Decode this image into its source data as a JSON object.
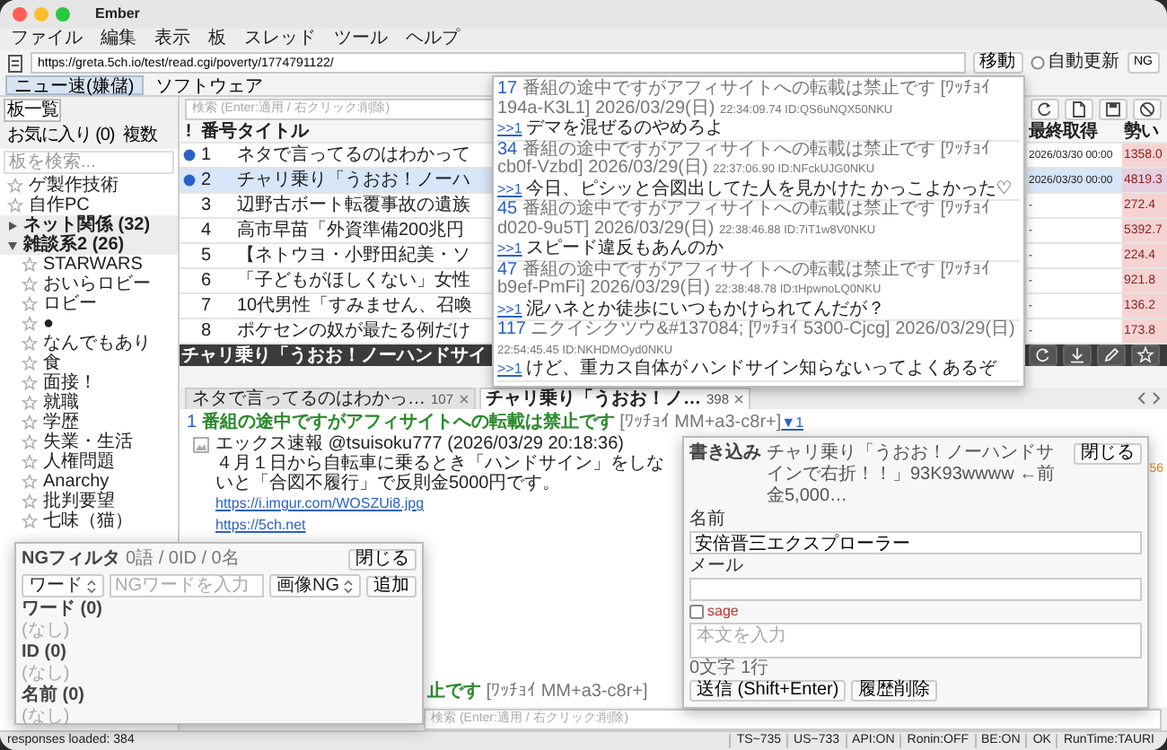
{
  "window": {
    "title": "Ember"
  },
  "menu": [
    "ファイル",
    "編集",
    "表示",
    "板",
    "スレッド",
    "ツール",
    "ヘルプ"
  ],
  "address_bar": {
    "url": "https://greta.5ch.io/test/read.cgi/poverty/1774791122/",
    "go_button": "移動",
    "auto_refresh": {
      "label": "自動更新",
      "checked": false
    },
    "ng_button": "NG"
  },
  "board_tabs": [
    {
      "label": "ニュー速(嫌儲)",
      "selected": true
    },
    {
      "label": "ソフトウェア",
      "selected": false
    }
  ],
  "sidebar": {
    "tabs": [
      {
        "label": "板一覧",
        "selected": true
      },
      {
        "label": "お気に入り (0)",
        "selected": false
      },
      {
        "label": "複数",
        "selected": false
      }
    ],
    "search": {
      "placeholder": "板を検索..."
    },
    "items": [
      {
        "kind": "board",
        "label": "ゲ製作技術"
      },
      {
        "kind": "board",
        "label": "自作PC"
      },
      {
        "kind": "category",
        "label": "ネット関係 (32)",
        "expanded": false
      },
      {
        "kind": "category",
        "label": "雑談系2 (26)",
        "expanded": true,
        "children": [
          {
            "kind": "board",
            "label": "STARWARS"
          },
          {
            "kind": "board",
            "label": "おいらロビー"
          },
          {
            "kind": "board",
            "label": "ロビー"
          },
          {
            "kind": "board",
            "label": "●"
          },
          {
            "kind": "board",
            "label": "なんでもあり"
          },
          {
            "kind": "board",
            "label": "食"
          },
          {
            "kind": "board",
            "label": "面接！"
          },
          {
            "kind": "board",
            "label": "就職"
          },
          {
            "kind": "board",
            "label": "学歴"
          },
          {
            "kind": "board",
            "label": "失業・生活"
          },
          {
            "kind": "board",
            "label": "人権問題"
          },
          {
            "kind": "board",
            "label": "Anarchy"
          },
          {
            "kind": "board",
            "label": "批判要望"
          },
          {
            "kind": "board",
            "label": "七味（猫）"
          }
        ]
      }
    ]
  },
  "thread_list": {
    "filter": {
      "placeholder": "検索 (Enter:適用 / 右クリック:削除)"
    },
    "columns": [
      "!",
      "番号",
      "タイトル",
      "最終取得",
      "勢い"
    ],
    "rows": [
      {
        "unread": true,
        "selected": false,
        "number": "1",
        "title": "ネタで言ってるのはわかって",
        "last": "2026/03/30 00:00",
        "momentum": "1358.0"
      },
      {
        "unread": true,
        "selected": true,
        "number": "2",
        "title": "チャリ乗り「うおお！ノーハ",
        "last": "2026/03/30 00:00",
        "momentum": "4819.3"
      },
      {
        "unread": false,
        "selected": false,
        "number": "3",
        "title": "辺野古ボート転覆事故の遺族",
        "last": "-",
        "momentum": "272.4"
      },
      {
        "unread": false,
        "selected": false,
        "number": "4",
        "title": "高市早苗「外資準備200兆円",
        "last": "-",
        "momentum": "5392.7"
      },
      {
        "unread": false,
        "selected": false,
        "number": "5",
        "title": "【ネトウヨ・小野田紀美・ソ",
        "last": "-",
        "momentum": "224.4"
      },
      {
        "unread": false,
        "selected": false,
        "number": "6",
        "title": "「子どもがほしくない」女性",
        "last": "-",
        "momentum": "921.8"
      },
      {
        "unread": false,
        "selected": false,
        "number": "7",
        "title": "10代男性「すみません、召喚",
        "last": "-",
        "momentum": "136.2"
      },
      {
        "unread": false,
        "selected": false,
        "number": "8",
        "title": "ポケセンの奴が最たる例だけ",
        "last": "-",
        "momentum": "173.8"
      }
    ]
  },
  "reply_popup": {
    "replies": [
      {
        "number": "17",
        "name": "番組の途中ですがアフィサイトへの転載は禁止です",
        "wacchoi": "[ﾜｯﾁｮｲ 194a-K3L1]",
        "date": "2026/03/29(日)",
        "time_id": "22:34:09.74 ID:QS6uNQX50NKU",
        "anchor": ">>1",
        "body": [
          "デマを混ぜるのやめろよ"
        ]
      },
      {
        "number": "34",
        "name": "番組の途中ですがアフィサイトへの転載は禁止です",
        "wacchoi": "[ﾜｯﾁｮｲ cb0f-Vzbd]",
        "date": "2026/03/29(日)",
        "time_id": "22:37:06.90 ID:NFckUJG0NKU",
        "anchor": ">>1",
        "body": [
          "今日、ピシッと合図出してた人を見かけた",
          "かっこよかった♡"
        ]
      },
      {
        "number": "45",
        "name": "番組の途中ですがアフィサイトへの転載は禁止です",
        "wacchoi": "[ﾜｯﾁｮｲ d020-9u5T]",
        "date": "2026/03/29(日)",
        "time_id": "22:38:46.88 ID:7iT1w8V0NKU",
        "anchor": ">>1",
        "body": [
          "スピード違反もあんのか"
        ]
      },
      {
        "number": "47",
        "name": "番組の途中ですがアフィサイトへの転載は禁止です",
        "wacchoi": "[ﾜｯﾁｮｲ b9ef-PmFi]",
        "date": "2026/03/29(日)",
        "time_id": "22:38:48.78 ID:tHpwnoLQ0NKU",
        "anchor": ">>1",
        "body": [
          "泥ハネとか徒歩にいつもかけられてんだが？"
        ]
      },
      {
        "number": "117",
        "name": "ニクイシクツウ&#137084;",
        "wacchoi": "[ﾜｯﾁｮｲ 5300-Cjcg]",
        "date": "2026/03/29(日)",
        "time_id": "22:54:45.45 ID:NKHDMOyd0NKU",
        "anchor": ">>1",
        "body": [
          "けど、重カス自体が",
          "ハンドサイン知らないってよくあるぞ"
        ]
      }
    ]
  },
  "thread_view": {
    "title": "チャリ乗り「うおお！ノーハンドサイ",
    "tabs": [
      {
        "label": "ネタで言ってるのはわかっ…",
        "count": "107",
        "selected": false
      },
      {
        "label": "チャリ乗り「うおお！ノ…",
        "count": "398",
        "selected": true
      }
    ],
    "posts": [
      {
        "number": "1",
        "name": "番組の途中ですがアフィサイトへの転載は禁止です",
        "meta": "[ﾜｯﾁｮｲ MM+a3-c8r+]",
        "replies": "▼1",
        "thumbnail": true,
        "lines": [
          {
            "kind": "text",
            "text": "エックス速報 @tsuisoku777 (2026/03/29 20:18:36)"
          },
          {
            "kind": "text",
            "text": "４月１日から自転車に乗るとき「ハンドサイン」をしないと「合図不履行」で反則金5000円です。"
          },
          {
            "kind": "link",
            "text": "https://i.imgur.com/WOSZUi8.jpg"
          },
          {
            "kind": "link",
            "text": "https://5ch.net"
          }
        ]
      },
      {
        "name": "止です",
        "meta": "[ﾜｯﾁｮｲ MM+a3-c8r+]",
        "thumbnail": false
      }
    ],
    "side_count": "56",
    "filter": {
      "placeholder": "検索 (Enter:適用 / 右クリック:削除)"
    }
  },
  "ng_filter": {
    "title": "NGフィルタ",
    "summary": "0語 / 0ID / 0名",
    "close": "閉じる",
    "type_select": "ワード",
    "input_placeholder": "NGワードを入力",
    "mode_select": "画像NG",
    "add": "追加",
    "sections": [
      {
        "heading": "ワード (0)",
        "empty": "(なし)"
      },
      {
        "heading": "ID (0)",
        "empty": "(なし)"
      },
      {
        "heading": "名前 (0)",
        "empty": "(なし)"
      }
    ]
  },
  "write_dialog": {
    "title": "書き込み",
    "thread": "チャリ乗り「うおお！ノーハンドサインで右折！！」93K93wwww ←前金5,000…",
    "close": "閉じる",
    "name_label": "名前",
    "name_value": "安倍晋三エクスプローラー",
    "mail_label": "メール",
    "sage": {
      "label": "sage",
      "checked": false
    },
    "body_placeholder": "本文を入力",
    "chars": "0文字",
    "lines": "1行",
    "submit": "送信 (Shift+Enter)",
    "history": "履歴削除"
  },
  "status_bar": {
    "left": "responses loaded: 384",
    "items": [
      "TS~735",
      "US~733",
      "API:ON",
      "Ronin:OFF",
      "BE:ON",
      "OK",
      "RunTime:TAURI"
    ]
  }
}
